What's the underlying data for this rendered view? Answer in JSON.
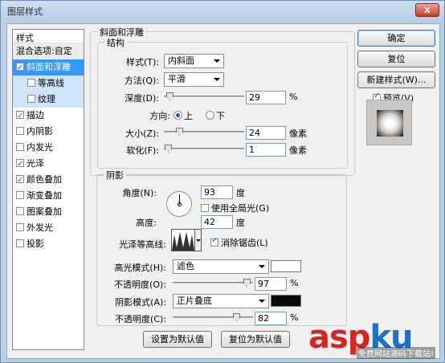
{
  "window": {
    "title": "图层样式",
    "close": "x"
  },
  "list": {
    "header": "样式",
    "items": [
      {
        "label": "混合选项:自定",
        "checkbox": false,
        "checked": false,
        "state": "normal"
      },
      {
        "label": "斜面和浮雕",
        "checkbox": true,
        "checked": true,
        "state": "selected"
      },
      {
        "label": "等高线",
        "checkbox": true,
        "checked": false,
        "state": "sub"
      },
      {
        "label": "纹理",
        "checkbox": true,
        "checked": false,
        "state": "sub"
      },
      {
        "label": "描边",
        "checkbox": true,
        "checked": true,
        "state": "normal"
      },
      {
        "label": "内阴影",
        "checkbox": true,
        "checked": false,
        "state": "normal"
      },
      {
        "label": "内发光",
        "checkbox": true,
        "checked": false,
        "state": "normal"
      },
      {
        "label": "光泽",
        "checkbox": true,
        "checked": true,
        "state": "normal"
      },
      {
        "label": "颜色叠加",
        "checkbox": true,
        "checked": true,
        "state": "normal"
      },
      {
        "label": "渐变叠加",
        "checkbox": true,
        "checked": false,
        "state": "normal"
      },
      {
        "label": "图案叠加",
        "checkbox": true,
        "checked": false,
        "state": "normal"
      },
      {
        "label": "外发光",
        "checkbox": true,
        "checked": false,
        "state": "normal"
      },
      {
        "label": "投影",
        "checkbox": true,
        "checked": false,
        "state": "normal"
      }
    ]
  },
  "bevel": {
    "group_title": "斜面和浮雕",
    "structure_title": "结构",
    "style_label": "样式(T):",
    "style_value": "内斜面",
    "technique_label": "方法(Q):",
    "technique_value": "平滑",
    "depth_label": "深度(D):",
    "depth_value": "29",
    "depth_unit": "%",
    "direction_label": "方向:",
    "dir_up": "上",
    "dir_down": "下",
    "size_label": "大小(Z):",
    "size_value": "24",
    "size_unit": "像素",
    "soften_label": "软化(F):",
    "soften_value": "1",
    "soften_unit": "像素",
    "depth_level": 0.03,
    "size_level": 0.16,
    "soften_level": 0.01
  },
  "shading": {
    "title": "阴影",
    "angle_label": "角度(N):",
    "angle_value": "93",
    "angle_unit": "度",
    "global_light": "使用全局光(G)",
    "altitude_label": "高度:",
    "altitude_value": "42",
    "altitude_unit": "度",
    "gloss_label": "光泽等高线:",
    "antialias": "消除锯齿(L)",
    "highlight_mode_label": "高光模式(H):",
    "highlight_mode": "滤色",
    "highlight_color": "#ffffff",
    "highlight_opacity_label": "不透明度(O):",
    "highlight_opacity": "97",
    "highlight_opacity_unit": "%",
    "shadow_mode_label": "阴影模式(A):",
    "shadow_mode": "正片叠底",
    "shadow_color": "#0a0a0a",
    "shadow_opacity_label": "不透明度(C):",
    "shadow_opacity": "82",
    "shadow_opacity_unit": "%",
    "highlight_opacity_level": 0.97,
    "shadow_opacity_level": 0.82
  },
  "footer": {
    "set_default": "设置为默认值",
    "reset_default": "复位为默认值"
  },
  "buttons": {
    "ok": "确定",
    "reset": "复位",
    "new_style": "新建样式(W)...",
    "preview": "预览(V)"
  },
  "watermark": {
    "asp": "asp",
    "ku": "ku",
    "sub": "免费网站源码下载站!"
  }
}
